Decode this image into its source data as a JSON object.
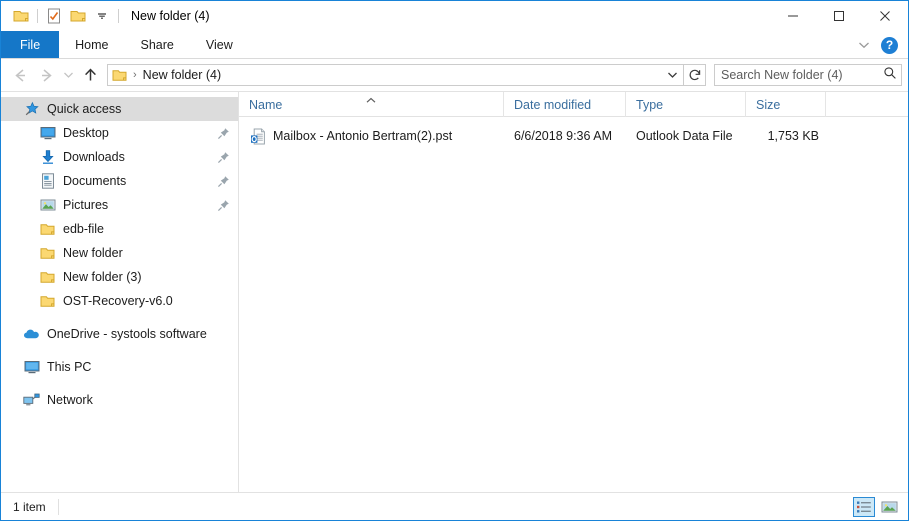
{
  "window": {
    "title": "New folder (4)",
    "accent_color": "#1577c8",
    "border_color": "#1883d7",
    "selection_color": "#dcdcdc",
    "header_text_color": "#3a6e9e"
  },
  "quick_access_toolbar": {
    "items": [
      {
        "name": "folder-icon",
        "label": "Properties folder"
      },
      {
        "name": "properties-icon",
        "label": "Properties"
      },
      {
        "name": "new-folder-icon",
        "label": "New folder"
      },
      {
        "name": "customize-chevron-icon",
        "label": "Customize Quick Access Toolbar"
      }
    ]
  },
  "window_controls": {
    "minimize": "Minimize",
    "maximize": "Maximize",
    "close": "Close"
  },
  "ribbon": {
    "tabs": [
      {
        "label": "File",
        "active": true
      },
      {
        "label": "Home",
        "active": false
      },
      {
        "label": "Share",
        "active": false
      },
      {
        "label": "View",
        "active": false
      }
    ],
    "collapse_label": "Minimize the Ribbon",
    "help_label": "?"
  },
  "navigation": {
    "back": "Back",
    "forward": "Forward",
    "recent": "Recent locations",
    "up": "Up one level",
    "address": {
      "breadcrumb": "New folder (4)",
      "separator": "›"
    },
    "refresh": "Refresh",
    "search": {
      "placeholder": "Search New folder (4)",
      "value": ""
    }
  },
  "sidebar": {
    "items": [
      {
        "label": "Quick access",
        "icon": "quick-access-star-icon",
        "selected": true,
        "indent": false,
        "pinned": false
      },
      {
        "label": "Desktop",
        "icon": "desktop-icon",
        "selected": false,
        "indent": true,
        "pinned": true
      },
      {
        "label": "Downloads",
        "icon": "downloads-icon",
        "selected": false,
        "indent": true,
        "pinned": true
      },
      {
        "label": "Documents",
        "icon": "documents-icon",
        "selected": false,
        "indent": true,
        "pinned": true
      },
      {
        "label": "Pictures",
        "icon": "pictures-icon",
        "selected": false,
        "indent": true,
        "pinned": true
      },
      {
        "label": "edb-file",
        "icon": "folder-icon",
        "selected": false,
        "indent": true,
        "pinned": false
      },
      {
        "label": "New folder",
        "icon": "folder-icon",
        "selected": false,
        "indent": true,
        "pinned": false
      },
      {
        "label": "New folder (3)",
        "icon": "folder-icon",
        "selected": false,
        "indent": true,
        "pinned": false
      },
      {
        "label": "OST-Recovery-v6.0",
        "icon": "folder-icon",
        "selected": false,
        "indent": true,
        "pinned": false
      }
    ],
    "groups": [
      {
        "label": "OneDrive - systools software",
        "icon": "onedrive-icon"
      },
      {
        "label": "This PC",
        "icon": "this-pc-icon"
      },
      {
        "label": "Network",
        "icon": "network-icon"
      }
    ]
  },
  "filelist": {
    "columns": [
      {
        "label": "Name",
        "sorted": "asc"
      },
      {
        "label": "Date modified",
        "sorted": ""
      },
      {
        "label": "Type",
        "sorted": ""
      },
      {
        "label": "Size",
        "sorted": ""
      }
    ],
    "rows": [
      {
        "name": "Mailbox - Antonio Bertram(2).pst",
        "date": "6/6/2018 9:36 AM",
        "type": "Outlook Data File",
        "size": "1,753 KB",
        "icon": "outlook-pst-file-icon"
      }
    ]
  },
  "statusbar": {
    "count": "1 item",
    "views": [
      {
        "name": "details-view-button",
        "active": true
      },
      {
        "name": "large-icons-view-button",
        "active": false
      }
    ]
  }
}
